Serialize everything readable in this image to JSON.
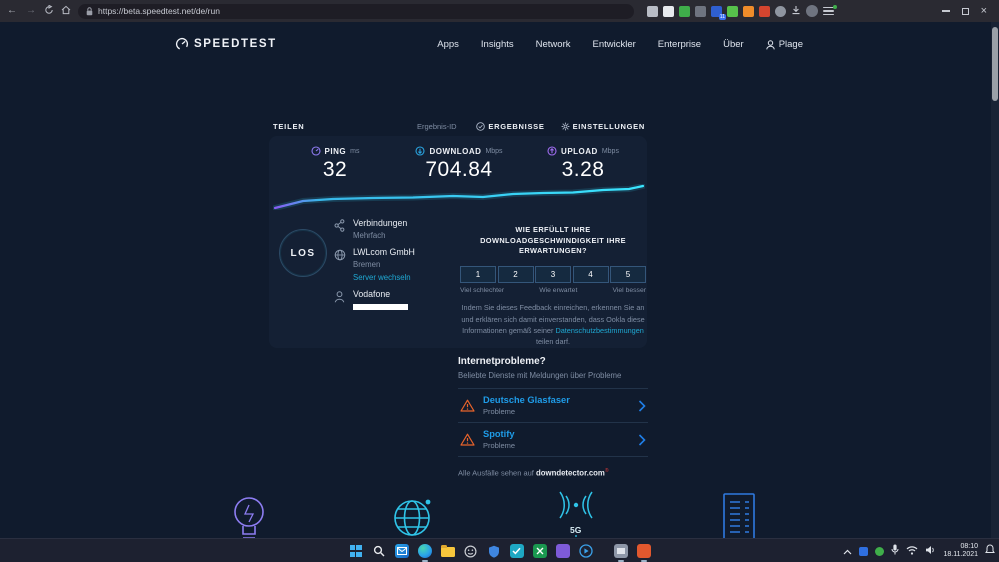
{
  "browser": {
    "url": "https://beta.speedtest.net/de/run",
    "extension_badge": "11"
  },
  "header": {
    "logo": "SPEEDTEST",
    "nav": [
      {
        "label": "Apps"
      },
      {
        "label": "Insights"
      },
      {
        "label": "Network"
      },
      {
        "label": "Entwickler"
      },
      {
        "label": "Enterprise"
      },
      {
        "label": "Über"
      }
    ],
    "account": "Plage"
  },
  "toolbar": {
    "share": "TEILEN",
    "result_id": "Ergebnis-ID",
    "results": "ERGEBNISSE",
    "settings": "EINSTELLUNGEN"
  },
  "metrics": [
    {
      "label": "PING",
      "unit": "ms",
      "value": "32"
    },
    {
      "label": "DOWNLOAD",
      "unit": "Mbps",
      "value": "704.84"
    },
    {
      "label": "UPLOAD",
      "unit": "Mbps",
      "value": "3.28"
    }
  ],
  "go_label": "LOS",
  "connection": {
    "connections_label": "Verbindungen",
    "connections_value": "Mehrfach",
    "isp": "LWLcom GmbH",
    "city": "Bremen",
    "change_server": "Server wechseln",
    "provider": "Vodafone"
  },
  "rating": {
    "title_line1": "WIE ERFÜLLT IHRE",
    "title_line2": "DOWNLOADGESCHWINDIGKEIT IHRE",
    "title_line3": "ERWARTUNGEN?",
    "scale": [
      "1",
      "2",
      "3",
      "4",
      "5"
    ],
    "labels": [
      "Viel schlechter",
      "Wie erwartet",
      "Viel besser"
    ],
    "disclaimer_before": "Indem Sie dieses Feedback einreichen, erkennen Sie an und erklären sich damit einverstanden, dass Ookla diese Informationen gemäß seiner ",
    "disclaimer_link": "Datenschutzbestimmungen",
    "disclaimer_after": " teilen darf."
  },
  "issues": {
    "title": "Internetprobleme?",
    "subtitle": "Beliebte Dienste mit Meldungen über Probleme",
    "services": [
      {
        "name": "Deutsche Glasfaser",
        "status": "Probleme"
      },
      {
        "name": "Spotify",
        "status": "Probleme"
      }
    ],
    "footer_prefix": "Alle Ausfälle sehen auf ",
    "footer_site": "downdetector.com",
    "footer_mark": "®"
  },
  "deco": {
    "antenna_label": "5G"
  },
  "taskbar": {
    "time": "08:10",
    "date": "18.11.2021"
  },
  "colors": {
    "accent_teal": "#2fd6f5",
    "link_blue": "#1fa8d2",
    "service_blue": "#1f9ce8",
    "warning_orange": "#e8632b",
    "page_bg": "#101b2d",
    "browser_bar": "#2a2a32",
    "taskbar_bg": "#1d2130"
  }
}
